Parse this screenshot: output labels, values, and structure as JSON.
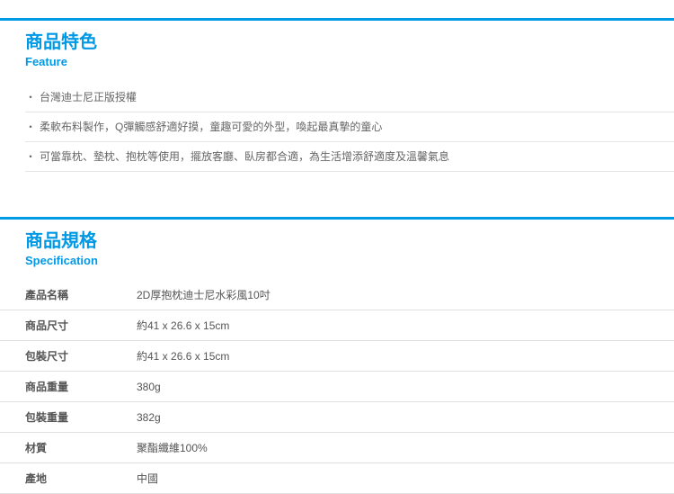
{
  "feature": {
    "title_zh": "商品特色",
    "title_en": "Feature",
    "items": [
      "台灣迪士尼正版授權",
      "柔軟布料製作，Q彈觸感舒適好摸，童趣可愛的外型，喚起最真摯的童心",
      "可當靠枕、墊枕、抱枕等使用，擺放客廳、臥房都合適，為生活增添舒適度及溫馨氣息"
    ]
  },
  "spec": {
    "title_zh": "商品規格",
    "title_en": "Specification",
    "rows": [
      {
        "label": "產品名稱",
        "value": "2D厚抱枕迪士尼水彩風10吋"
      },
      {
        "label": "商品尺寸",
        "value": "約41 x 26.6 x 15cm"
      },
      {
        "label": "包裝尺寸",
        "value": "約41 x 26.6 x 15cm"
      },
      {
        "label": "商品重量",
        "value": "380g"
      },
      {
        "label": "包裝重量",
        "value": "382g"
      },
      {
        "label": "材質",
        "value": "聚酯纖維100%"
      },
      {
        "label": "產地",
        "value": "中國"
      }
    ]
  }
}
